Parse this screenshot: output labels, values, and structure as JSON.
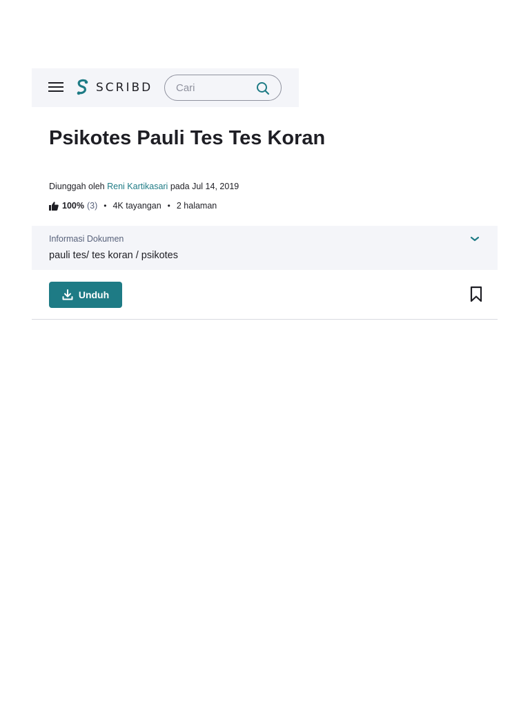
{
  "header": {
    "logo_text": "SCRIBD",
    "search_placeholder": "Cari"
  },
  "document": {
    "title": "Psikotes Pauli Tes Tes Koran",
    "uploaded_prefix": "Diunggah oleh",
    "uploader": "Reni Kartikasari",
    "uploaded_suffix": "pada Jul 14, 2019",
    "rating_percent": "100%",
    "rating_count": "(3)",
    "views": "4K tayangan",
    "pages": "2 halaman"
  },
  "info": {
    "label": "Informasi Dokumen",
    "value": "pauli tes/ tes koran / psikotes"
  },
  "actions": {
    "download_label": "Unduh"
  },
  "colors": {
    "accent": "#1e7b85",
    "panel_bg": "#f4f5f9",
    "text": "#1e1e24"
  }
}
